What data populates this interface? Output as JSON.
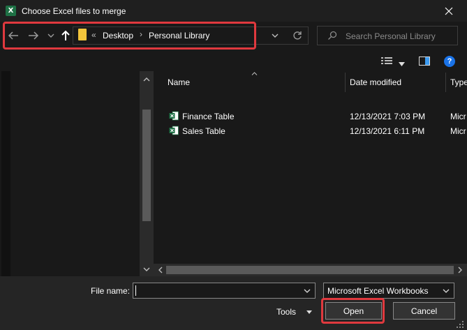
{
  "window": {
    "title": "Choose Excel files to merge",
    "app_icon_letter": "X",
    "close_glyph": "✕"
  },
  "nav": {
    "back_icon": "back-arrow-icon",
    "forward_icon": "forward-arrow-icon",
    "recent_icon": "chevron-down-icon",
    "up_icon": "up-arrow-icon",
    "breadcrumb_prefix": "«",
    "breadcrumbs": [
      {
        "label": "Desktop"
      },
      {
        "label": "Personal Library"
      }
    ],
    "crumb_separator": "›",
    "refresh_icon": "refresh-icon"
  },
  "search": {
    "placeholder": "Search Personal Library"
  },
  "toolbar": {
    "help_label": "?"
  },
  "file_list": {
    "columns": [
      {
        "label": "Name"
      },
      {
        "label": "Date modified"
      },
      {
        "label": "Type"
      }
    ],
    "rows": [
      {
        "name": "Finance Table",
        "date": "12/13/2021 7:03 PM",
        "type": "Micr"
      },
      {
        "name": "Sales Table",
        "date": "12/13/2021 6:11 PM",
        "type": "Micr"
      }
    ]
  },
  "bottom": {
    "file_name_label": "File name:",
    "file_name_value": "",
    "file_type_selected": "Microsoft Excel Workbooks",
    "tools_label": "Tools",
    "open_label": "Open",
    "cancel_label": "Cancel"
  },
  "colors": {
    "highlight": "#e0393e",
    "folder": "#f3c53b",
    "excel_green": "#1e7145",
    "help_blue": "#1a73e8"
  }
}
